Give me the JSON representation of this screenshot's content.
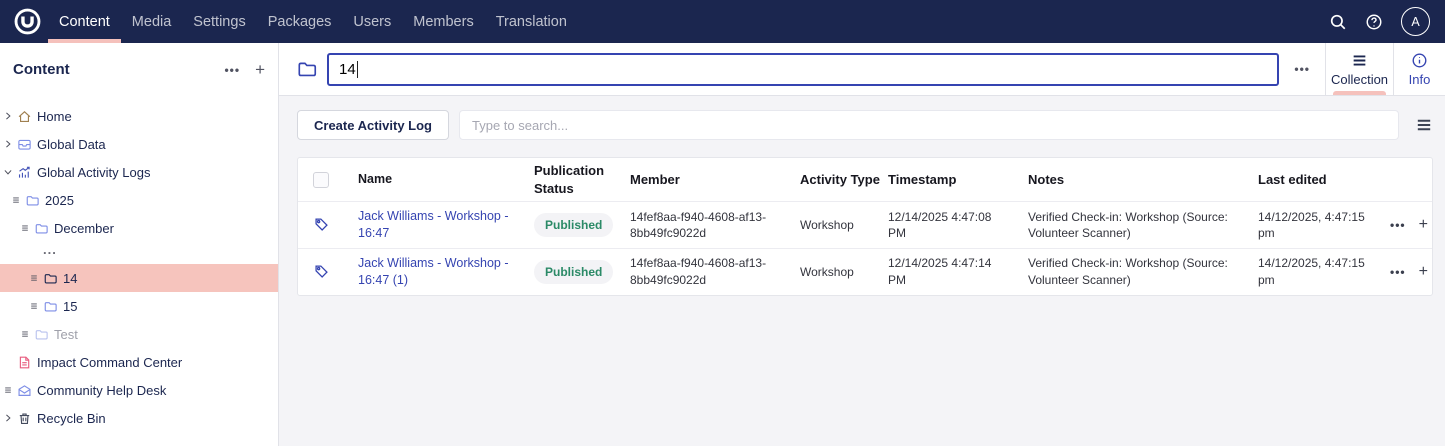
{
  "colors": {
    "navbar_bg": "#1b264f",
    "accent_pink": "#f5c1bc",
    "selected_row_pink": "#f6c4bd",
    "link_blue": "#3544b1",
    "text_dark": "#1b264f",
    "published_green": "#2b8a67",
    "body_bg": "#f4f4f7",
    "border": "#e1e2e8"
  },
  "topnav": {
    "items": [
      {
        "label": "Content",
        "active": true
      },
      {
        "label": "Media",
        "active": false
      },
      {
        "label": "Settings",
        "active": false
      },
      {
        "label": "Packages",
        "active": false
      },
      {
        "label": "Users",
        "active": false
      },
      {
        "label": "Members",
        "active": false
      },
      {
        "label": "Translation",
        "active": false
      }
    ],
    "right_icons": [
      "search-icon",
      "help-icon",
      "avatar"
    ],
    "avatar_initial": "A"
  },
  "sidebar": {
    "title": "Content",
    "more_label": "•••",
    "add_label": "+",
    "tree": [
      {
        "label": "Home",
        "icon": "home",
        "icon_color": "#a08050",
        "chevron": "right",
        "indent": 0
      },
      {
        "label": "Global Data",
        "icon": "storage",
        "icon_color": "#7e8ee6",
        "chevron": "right",
        "indent": 0
      },
      {
        "label": "Global Activity Logs",
        "icon": "chart",
        "icon_color": "#4353b8",
        "chevron": "down",
        "indent": 0
      },
      {
        "label": "2025",
        "icon": "folder",
        "icon_color": "#7e8ee6",
        "handle": true,
        "indent": 1
      },
      {
        "label": "December",
        "icon": "folder",
        "icon_color": "#7e8ee6",
        "handle": true,
        "indent": 2
      },
      {
        "label": "...",
        "ellipsis": true,
        "indent": 3
      },
      {
        "label": "14",
        "icon": "folder",
        "icon_color": "#1b264f",
        "handle": true,
        "indent": 3,
        "selected": true
      },
      {
        "label": "15",
        "icon": "folder",
        "icon_color": "#7e8ee6",
        "handle": true,
        "indent": 3
      },
      {
        "label": "Test",
        "icon": "folder",
        "icon_color": "#b9c2ee",
        "handle": true,
        "indent": 2,
        "muted": true
      },
      {
        "label": "Impact Command Center",
        "icon": "document",
        "icon_color": "#e85c7f",
        "indent": 0
      },
      {
        "label": "Community Help Desk",
        "icon": "mail",
        "icon_color": "#7e8ee6",
        "handle": true,
        "indent": 0
      },
      {
        "label": "Recycle Bin",
        "icon": "trash",
        "icon_color": "#434a5c",
        "chevron": "right",
        "indent": 0
      }
    ]
  },
  "content_header": {
    "name_value": "14",
    "more_label": "•••",
    "tabs": [
      {
        "label": "Collection",
        "icon": "list-icon",
        "active": true
      },
      {
        "label": "Info",
        "icon": "info-icon",
        "active": false
      }
    ]
  },
  "toolbar": {
    "create_button": "Create Activity Log",
    "search_placeholder": "Type to search..."
  },
  "table": {
    "columns": [
      "Name",
      "Publication Status",
      "Member",
      "Activity Type",
      "Timestamp",
      "Notes",
      "Last edited"
    ],
    "row_actions": {
      "more": "•••",
      "add": "+"
    },
    "rows": [
      {
        "name": "Jack Williams - Workshop - 16:47",
        "status": "Published",
        "member": "14fef8aa-f940-4608-af13-8bb49fc9022d",
        "activity_type": "Workshop",
        "timestamp": "12/14/2025 4:47:08 PM",
        "notes": "Verified Check-in: Workshop (Source: Volunteer Scanner)",
        "last_edited": "14/12/2025, 4:47:15 pm"
      },
      {
        "name": "Jack Williams - Workshop - 16:47 (1)",
        "status": "Published",
        "member": "14fef8aa-f940-4608-af13-8bb49fc9022d",
        "activity_type": "Workshop",
        "timestamp": "12/14/2025 4:47:14 PM",
        "notes": "Verified Check-in: Workshop (Source: Volunteer Scanner)",
        "last_edited": "14/12/2025, 4:47:15 pm"
      }
    ]
  }
}
